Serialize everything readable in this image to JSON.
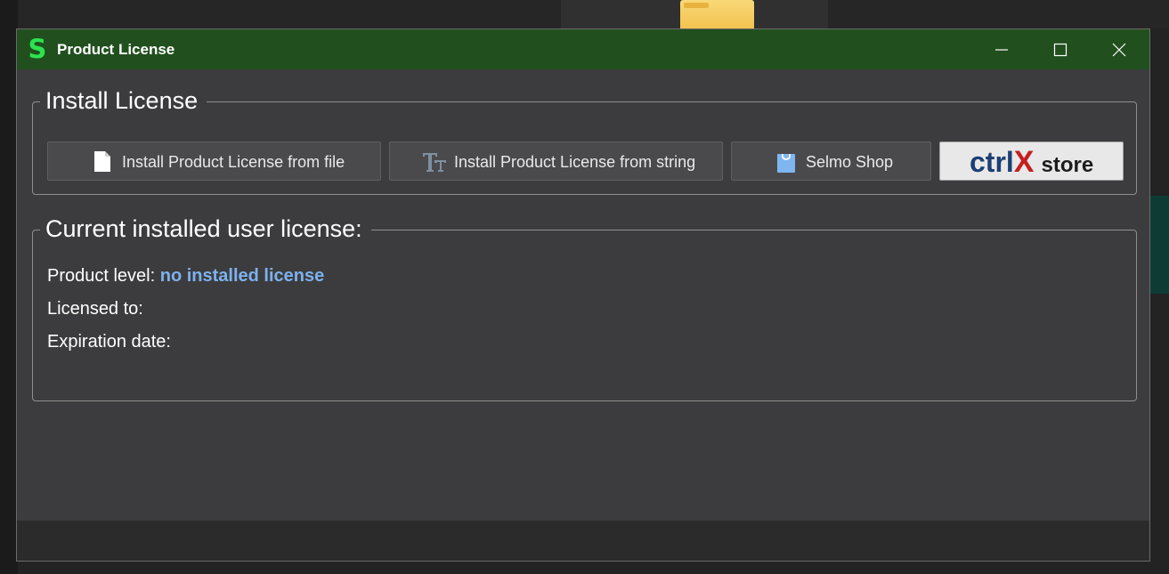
{
  "window": {
    "title": "Product License",
    "app_icon_letter": "S"
  },
  "title_controls": {
    "minimize": "minimize",
    "maximize": "maximize",
    "close": "close"
  },
  "install_group": {
    "title": "Install License",
    "buttons": {
      "from_file": "Install Product License from file",
      "from_string": "Install Product License from string",
      "shop": "Selmo Shop",
      "ctrlx_store": {
        "brand_main": "ctrl",
        "brand_x": "X",
        "brand_suffix": "store"
      }
    },
    "icons": {
      "from_file": "file-icon",
      "from_string": "text-icon",
      "shop": "shopping-bag-icon"
    }
  },
  "current_group": {
    "title": "Current installed user license:",
    "product_level_label": "Product level:",
    "product_level_value": "no installed license",
    "licensed_to_label": "Licensed to:",
    "expiration_label": "Expiration date:"
  },
  "colors": {
    "titlebar": "#21501e",
    "accent_link": "#7eb1ee",
    "window_bg": "#3c3c3e",
    "ctrlx_blue": "#1c3f74",
    "ctrlx_red": "#c51f1f"
  }
}
